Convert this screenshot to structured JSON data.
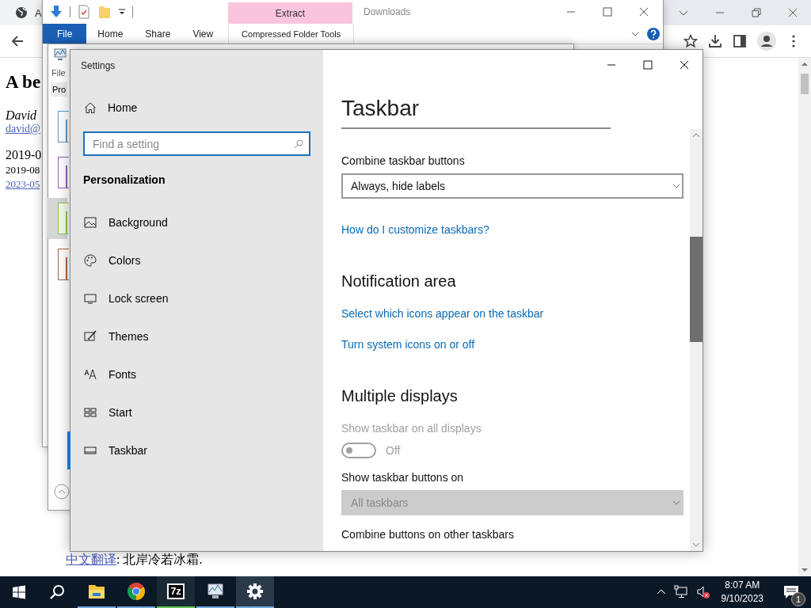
{
  "browser": {
    "tab_title": "A",
    "page": {
      "heading": "A be",
      "author": "David ",
      "email": "david@",
      "date_1": "2019-0",
      "date_2": "2019-08",
      "date_link": "2023-05",
      "translation_link": "中文翻译",
      "translation_text": ": 北岸冷若冰霜."
    }
  },
  "explorer": {
    "title": "Downloads",
    "contextual_tab": "Extract",
    "contextual_group": "Compressed Folder Tools",
    "ribbon_tabs": [
      {
        "label": "File",
        "selected": true
      },
      {
        "label": "Home",
        "selected": false
      },
      {
        "label": "Share",
        "selected": false
      },
      {
        "label": "View",
        "selected": false
      }
    ]
  },
  "back_window": {
    "menu": "File",
    "tab": "Pro",
    "thumbnails": [
      {
        "color": "#5a9cc8",
        "selected": false
      },
      {
        "color": "#9a5cc0",
        "selected": false
      },
      {
        "color": "#8ec850",
        "selected": true
      },
      {
        "color": "#b0683a",
        "selected": false
      }
    ]
  },
  "settings": {
    "title": "Settings",
    "home": "Home",
    "search": {
      "placeholder": "Find a setting"
    },
    "category": "Personalization",
    "nav": [
      {
        "label": "Background",
        "selected": false
      },
      {
        "label": "Colors",
        "selected": false
      },
      {
        "label": "Lock screen",
        "selected": false
      },
      {
        "label": "Themes",
        "selected": false
      },
      {
        "label": "Fonts",
        "selected": false
      },
      {
        "label": "Start",
        "selected": false
      },
      {
        "label": "Taskbar",
        "selected": true
      }
    ],
    "page_title": "Taskbar",
    "items": [
      {
        "kind": "label",
        "text": "Combine taskbar buttons",
        "disabled": false
      },
      {
        "kind": "dropdown",
        "value": "Always, hide labels",
        "disabled": false
      },
      {
        "kind": "link",
        "text": "How do I customize taskbars?"
      },
      {
        "kind": "heading",
        "text": "Notification area"
      },
      {
        "kind": "link",
        "text": "Select which icons appear on the taskbar"
      },
      {
        "kind": "link",
        "text": "Turn system icons on or off"
      },
      {
        "kind": "heading",
        "text": "Multiple displays"
      },
      {
        "kind": "label",
        "text": "Show taskbar on all displays",
        "disabled": true
      },
      {
        "kind": "toggle",
        "on": false,
        "text": "Off",
        "disabled": true
      },
      {
        "kind": "label",
        "text": "Show taskbar buttons on",
        "disabled": false
      },
      {
        "kind": "dropdown",
        "value": "All taskbars",
        "disabled": true
      },
      {
        "kind": "label",
        "text": "Combine buttons on other taskbars",
        "disabled": false
      }
    ]
  },
  "taskbar": {
    "apps": [
      {
        "running": true,
        "selected": false
      },
      {
        "running": true,
        "selected": false
      },
      {
        "label": "7z",
        "running": true,
        "selected": false
      },
      {
        "running": true,
        "selected": false
      },
      {
        "running": true,
        "selected": true
      }
    ],
    "time": "8:07 AM",
    "date": "9/10/2023",
    "notifications": "1"
  }
}
